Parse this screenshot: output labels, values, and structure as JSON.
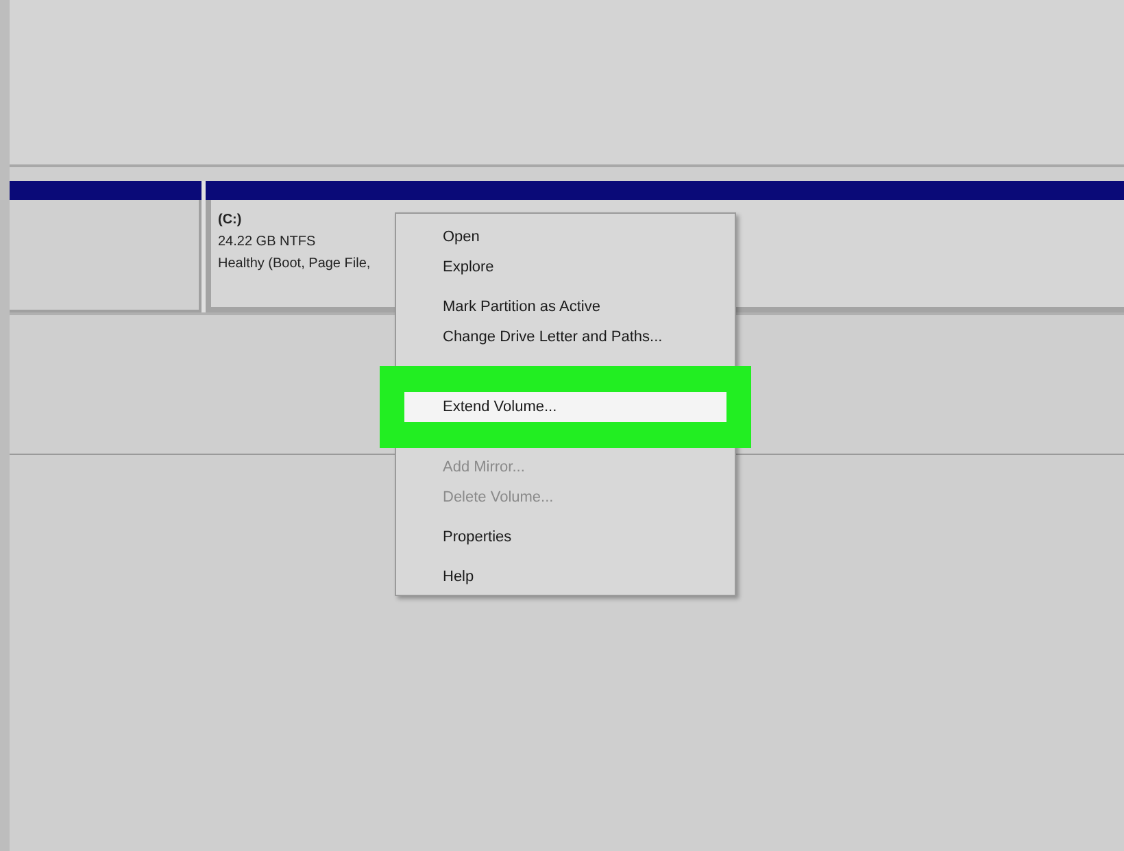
{
  "volume": {
    "name": "(C:)",
    "size": "24.22 GB NTFS",
    "status": "Healthy (Boot, Page File,"
  },
  "context_menu": {
    "items": [
      {
        "kind": "item",
        "label": "Open",
        "disabled": false,
        "selected": false
      },
      {
        "kind": "item",
        "label": "Explore",
        "disabled": false,
        "selected": false
      },
      {
        "kind": "separator"
      },
      {
        "kind": "item",
        "label": "Mark Partition as Active",
        "disabled": false,
        "selected": false
      },
      {
        "kind": "item",
        "label": "Change Drive Letter and Paths...",
        "disabled": false,
        "selected": false
      },
      {
        "kind": "covered"
      },
      {
        "kind": "separator"
      },
      {
        "kind": "item",
        "label": "Extend Volume...",
        "disabled": false,
        "selected": true
      },
      {
        "kind": "covered"
      },
      {
        "kind": "item",
        "label": "Add Mirror...",
        "disabled": true,
        "selected": false
      },
      {
        "kind": "item",
        "label": "Delete Volume...",
        "disabled": true,
        "selected": false
      },
      {
        "kind": "separator"
      },
      {
        "kind": "item",
        "label": "Properties",
        "disabled": false,
        "selected": false
      },
      {
        "kind": "separator"
      },
      {
        "kind": "item",
        "label": "Help",
        "disabled": false,
        "selected": false
      }
    ]
  }
}
